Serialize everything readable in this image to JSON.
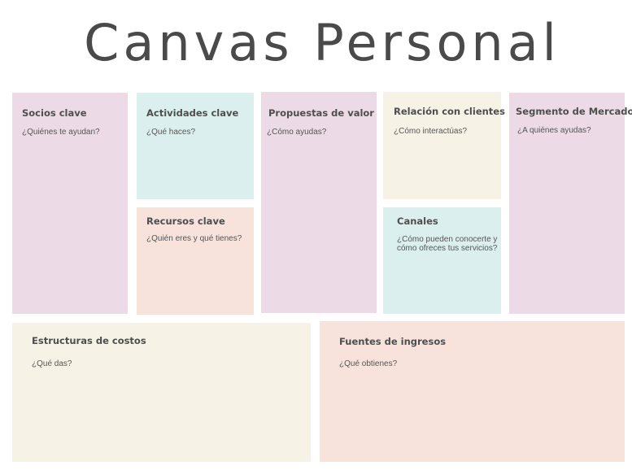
{
  "title": "Canvas Personal",
  "colors": {
    "pink": "#ecdbe6",
    "teal": "#dcefef",
    "cream": "#f6f2e6",
    "peach": "#f7e3dc",
    "text": "#4e4e4e"
  },
  "blocks": {
    "socios": {
      "heading": "Socios clave",
      "question": "¿Quiénes te ayudan?"
    },
    "actividades": {
      "heading": "Actividades clave",
      "question": "¿Qué haces?"
    },
    "recursos": {
      "heading": "Recursos clave",
      "question": "¿Quién eres y qué tienes?"
    },
    "propuestas": {
      "heading": "Propuestas de valor",
      "question": "¿Cómo ayudas?"
    },
    "relacion": {
      "heading": "Relación con clientes",
      "question": "¿Cómo interactúas?"
    },
    "canales": {
      "heading": "Canales",
      "question_line1": "¿Cómo pueden conocerte y",
      "question_line2": "cómo ofreces tus servicios?"
    },
    "segmento": {
      "heading": "Segmento de Mercado",
      "question": "¿A quiénes ayudas?"
    },
    "costos": {
      "heading": "Estructuras de costos",
      "question": "¿Qué das?"
    },
    "ingresos": {
      "heading": "Fuentes de ingresos",
      "question": "¿Qué obtienes?"
    }
  }
}
